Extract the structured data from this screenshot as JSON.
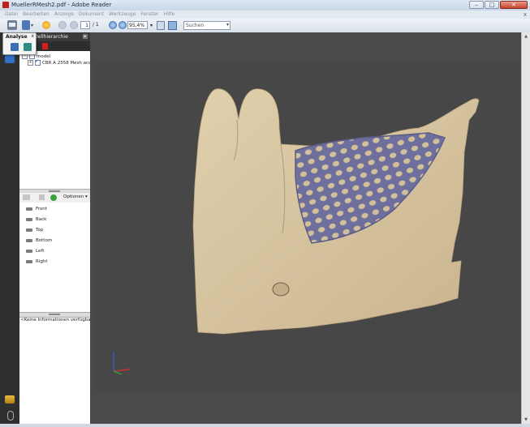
{
  "window": {
    "title": "MuellerRMesh2.pdf - Adobe Reader",
    "controls": {
      "minimize": "–",
      "maximize": "□",
      "close": "✕"
    }
  },
  "menu": {
    "items": [
      "Datei",
      "Bearbeiten",
      "Anzeige",
      "Dokument",
      "Werkzeuge",
      "Fenster",
      "Hilfe"
    ],
    "close_glyph": "x"
  },
  "toolbar": {
    "page_current": "1",
    "page_total": "/ 1",
    "zoom_value": "95,4%",
    "search_placeholder": "Suchen",
    "dropdown_glyph": "▾"
  },
  "analyse_flyout": {
    "label": "Analyse",
    "close_glyph": "x"
  },
  "model_panel": {
    "title": "Modellhierarchie",
    "menu_glyph": "▸",
    "tree": [
      {
        "label": "model",
        "expander": "−"
      },
      {
        "label": "CBR A 2558 Mesh anc",
        "expander": "+"
      }
    ],
    "views_options_label": "Optionen ▾",
    "views": [
      "Front",
      "Back",
      "Top",
      "Bottom",
      "Left",
      "Right"
    ],
    "info_text": "<Keine Informationen verfügbar>"
  },
  "scrollbar": {
    "up_glyph": "▲",
    "down_glyph": "▼"
  },
  "colors": {
    "viewport_background": "#474747",
    "bone": "#d7c5a2",
    "mesh": "#6e6f9c"
  },
  "icons": {
    "nav_top": "model-tree-icon",
    "nav_attach": "attachments-icon",
    "nav_clip": "paperclip-icon"
  }
}
